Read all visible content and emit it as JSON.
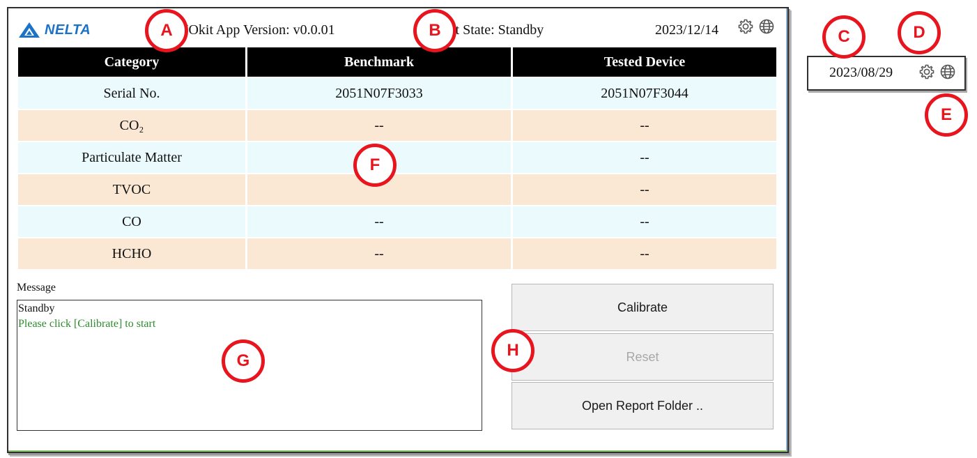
{
  "app": {
    "logo_text": "NELTA",
    "version_text": "NOkit App Version: v0.0.01",
    "state_text": "it State: Standby",
    "date": "2023/12/14"
  },
  "icons": {
    "settings": "gear-icon",
    "language": "globe-icon",
    "logo": "delta-triangle-icon"
  },
  "table": {
    "headers": [
      "Category",
      "Benchmark",
      "Tested Device"
    ],
    "rows": [
      [
        "Serial No.",
        "2051N07F3033",
        "2051N07F3044"
      ],
      [
        "CO₂",
        "--",
        "--"
      ],
      [
        "Particulate Matter",
        "",
        "--"
      ],
      [
        "TVOC",
        "",
        "--"
      ],
      [
        "CO",
        "--",
        "--"
      ],
      [
        "HCHO",
        "--",
        "--"
      ]
    ]
  },
  "message": {
    "label": "Message",
    "line1": "Standby",
    "line2": "Please click [Calibrate] to start"
  },
  "buttons": {
    "calibrate": "Calibrate",
    "reset": "Reset",
    "open_report": "Open Report Folder .."
  },
  "inset": {
    "date": "2023/08/29"
  },
  "callouts": [
    "A",
    "B",
    "C",
    "D",
    "E",
    "F",
    "G",
    "H"
  ],
  "colors": {
    "accent_red": "#e8141e",
    "brand_blue": "#1c73c6",
    "message_green": "#2e8b2e",
    "row_cyan": "#ebfbfd",
    "row_peach": "#fbe8d4"
  }
}
